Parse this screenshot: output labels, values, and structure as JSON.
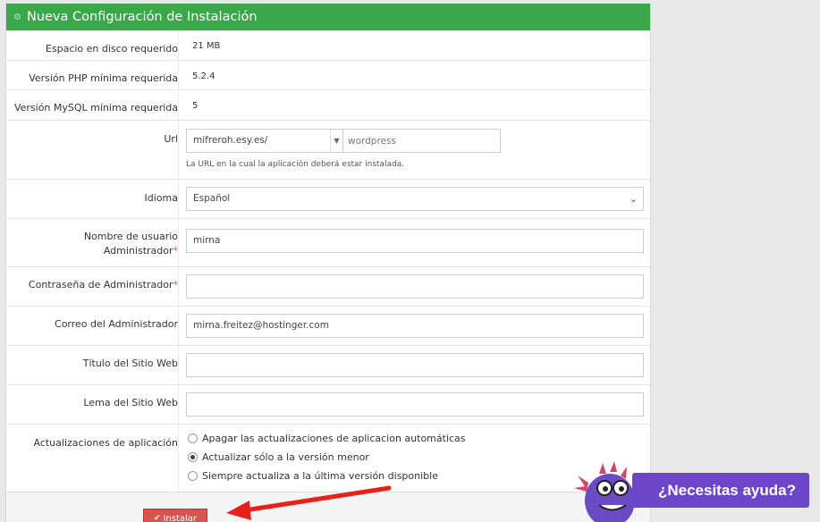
{
  "header": {
    "title": "Nueva Configuración de Instalación"
  },
  "rows": {
    "disk": {
      "label": "Espacio en disco requerido",
      "value": "21 MB"
    },
    "php": {
      "label": "Versión PHP mínima requerida",
      "value": "5.2.4"
    },
    "mysql": {
      "label": "Versión MySQL mínima requerida",
      "value": "5"
    }
  },
  "url": {
    "label": "Url",
    "domain": "mifreroh.esy.es/",
    "dir_placeholder": "wordpress",
    "hint": "La URL en la cual la aplicación deberá estar instalada."
  },
  "language": {
    "label": "Idioma",
    "selected": "Español"
  },
  "admin_user": {
    "label_line1": "Nombre de usuario",
    "label_line2": "Administrador",
    "required_mark": "*",
    "value": "mirna"
  },
  "admin_password": {
    "label": "Contraseña de Administrador",
    "required_mark": "*",
    "value": ""
  },
  "admin_email": {
    "label": "Correo del Administrador",
    "value": "mirna.freitez@hostinger.com"
  },
  "site_title": {
    "label": "Título del Sitio Web",
    "value": ""
  },
  "site_tagline": {
    "label": "Lema del Sitio Web",
    "value": ""
  },
  "updates": {
    "label": "Actualizaciones de aplicación",
    "options": [
      {
        "label": "Apagar las actualizaciones de aplicacion automáticas",
        "selected": false
      },
      {
        "label": "Actualizar sólo a la versión menor",
        "selected": true
      },
      {
        "label": "Siempre actualiza a la última versión disponible",
        "selected": false
      }
    ]
  },
  "install_button": {
    "label": "Instalar",
    "icon": "check-icon"
  },
  "help": {
    "label": "¿Necesitas ayuda?",
    "mascot": "monster-mascot"
  },
  "colors": {
    "header": "#3aa84a",
    "install": "#d9534f",
    "help": "#6d45c8"
  }
}
